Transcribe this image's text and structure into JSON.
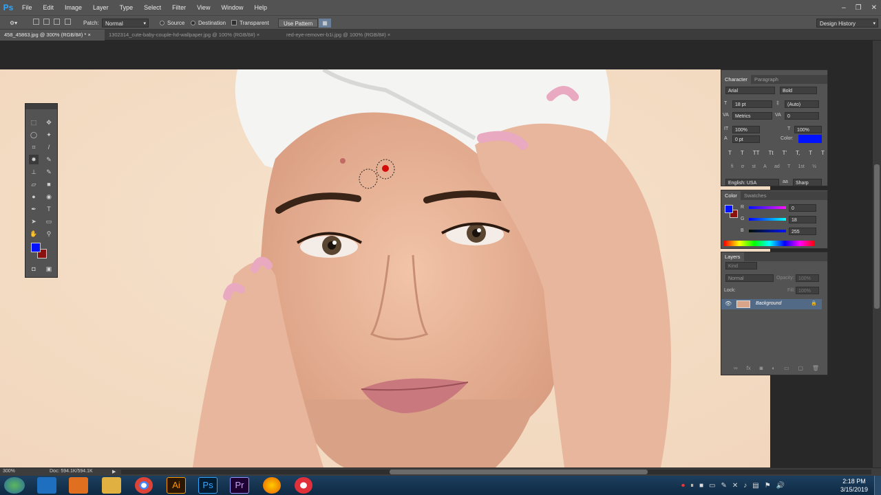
{
  "app": {
    "logo": "Ps"
  },
  "menu": [
    "File",
    "Edit",
    "Image",
    "Layer",
    "Type",
    "Select",
    "Filter",
    "View",
    "Window",
    "Help"
  ],
  "window_controls": {
    "minimize": "–",
    "restore": "❐",
    "close": "✕"
  },
  "options": {
    "patch_label": "Patch:",
    "patch_mode": "Normal",
    "source_label": "Source",
    "destination_label": "Destination",
    "transparent_label": "Transparent",
    "use_pattern_label": "Use Pattern",
    "workspace": "Design History"
  },
  "tabs": [
    {
      "label": "458_45863.jpg @ 300% (RGB/8#) *",
      "close": "×"
    },
    {
      "label": "1302314_cute-baby-couple-hd-wallpaper.jpg @ 100% (RGB/8#)",
      "close": "×"
    },
    {
      "label": "red-eye-remover-b1i.jpg @ 100% (RGB/8#)",
      "close": "×"
    }
  ],
  "character": {
    "tabs": [
      "Character",
      "Paragraph"
    ],
    "font": "Arial",
    "style": "Bold",
    "size": "18 pt",
    "leading": "(Auto)",
    "kerning": "Metrics",
    "tracking": "0",
    "vscale": "100%",
    "hscale": "100%",
    "baseline": "0 pt",
    "color_label": "Color:",
    "color": "#0012ff",
    "type_styles": [
      "T",
      "T",
      "TT",
      "Tt",
      "T'",
      "T,",
      "T",
      "T"
    ],
    "opentype": [
      "fi",
      "ơ",
      "st",
      "A",
      "ad",
      "T",
      "1st",
      "½"
    ],
    "language": "English: USA",
    "aa_label": "aa",
    "antialias": "Sharp"
  },
  "color_panel": {
    "tabs": [
      "Color",
      "Swatches"
    ],
    "channels": [
      {
        "label": "R",
        "value": "0"
      },
      {
        "label": "G",
        "value": "18"
      },
      {
        "label": "B",
        "value": "255"
      }
    ],
    "fg": "#0012ff",
    "bg": "#8b1010"
  },
  "layers": {
    "title": "Layers",
    "filter": "Kind",
    "blend": "Normal",
    "opacity_label": "Opacity:",
    "opacity": "100%",
    "lock_label": "Lock:",
    "fill_label": "Fill:",
    "fill": "100%",
    "items": [
      {
        "name": "Background"
      }
    ]
  },
  "status": {
    "zoom": "300%",
    "doc": "Doc: 594.1K/594.1K",
    "arrow": "▶"
  },
  "taskbar": {
    "time": "2:18 PM",
    "date": "3/15/2019"
  }
}
